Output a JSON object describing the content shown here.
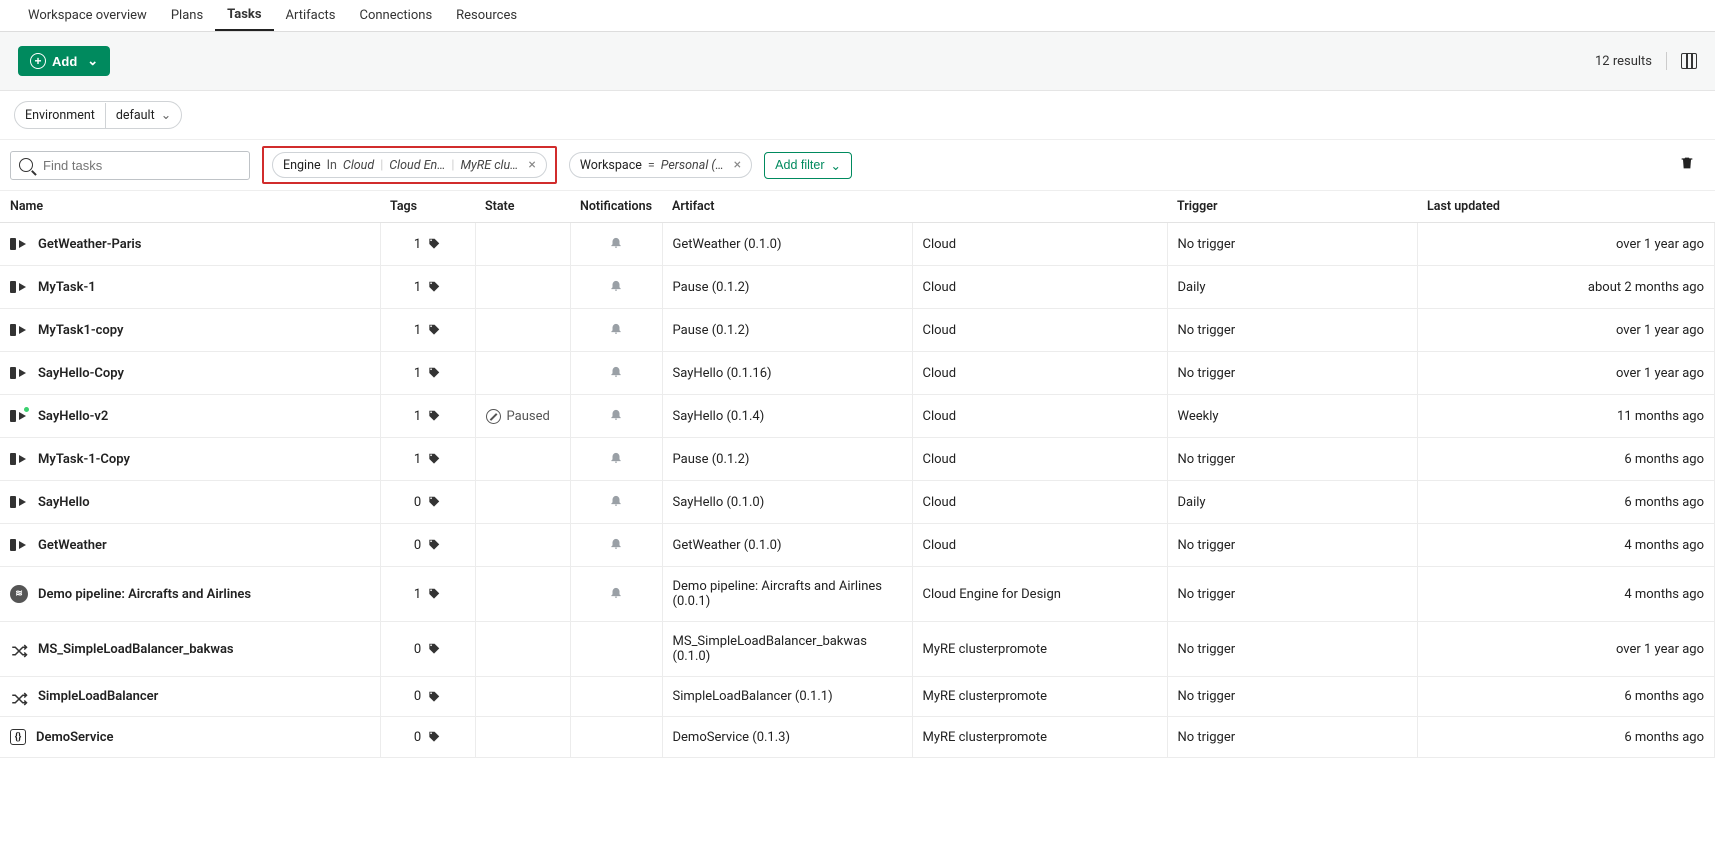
{
  "nav": {
    "items": [
      "Workspace overview",
      "Plans",
      "Tasks",
      "Artifacts",
      "Connections",
      "Resources"
    ],
    "active_index": 2
  },
  "toolbar": {
    "add_label": "Add",
    "results_text": "12 results"
  },
  "env_selector": {
    "label": "Environment",
    "value": "default"
  },
  "search": {
    "placeholder": "Find tasks"
  },
  "filters": {
    "engine": {
      "label": "Engine",
      "operator": "In",
      "values": [
        "Cloud",
        "Cloud En…",
        "MyRE clu…"
      ]
    },
    "workspace": {
      "label": "Workspace",
      "operator": "=",
      "value": "Personal (…"
    },
    "add_filter_label": "Add filter"
  },
  "columns": {
    "name": "Name",
    "tags": "Tags",
    "state": "State",
    "notifications": "Notifications",
    "artifact": "Artifact",
    "engine": "",
    "trigger": "Trigger",
    "last_updated": "Last updated"
  },
  "states": {
    "paused": "Paused"
  },
  "rows": [
    {
      "icon": "task",
      "name": "GetWeather-Paris",
      "tag_count": 1,
      "state": "",
      "notif": true,
      "artifact": "GetWeather (0.1.0)",
      "engine": "Cloud",
      "trigger": "No trigger",
      "updated": "over 1 year ago"
    },
    {
      "icon": "task",
      "name": "MyTask-1",
      "tag_count": 1,
      "state": "",
      "notif": true,
      "artifact": "Pause (0.1.2)",
      "engine": "Cloud",
      "trigger": "Daily",
      "updated": "about 2 months ago"
    },
    {
      "icon": "task",
      "name": "MyTask1-copy",
      "tag_count": 1,
      "state": "",
      "notif": true,
      "artifact": "Pause (0.1.2)",
      "engine": "Cloud",
      "trigger": "No trigger",
      "updated": "over 1 year ago"
    },
    {
      "icon": "task",
      "name": "SayHello-Copy",
      "tag_count": 1,
      "state": "",
      "notif": true,
      "artifact": "SayHello (0.1.16)",
      "engine": "Cloud",
      "trigger": "No trigger",
      "updated": "over 1 year ago"
    },
    {
      "icon": "task-dot",
      "name": "SayHello-v2",
      "tag_count": 1,
      "state": "Paused",
      "notif": true,
      "artifact": "SayHello (0.1.4)",
      "engine": "Cloud",
      "trigger": "Weekly",
      "updated": "11 months ago"
    },
    {
      "icon": "task",
      "name": "MyTask-1-Copy",
      "tag_count": 1,
      "state": "",
      "notif": true,
      "artifact": "Pause (0.1.2)",
      "engine": "Cloud",
      "trigger": "No trigger",
      "updated": "6 months ago"
    },
    {
      "icon": "task",
      "name": "SayHello",
      "tag_count": 0,
      "state": "",
      "notif": true,
      "artifact": "SayHello (0.1.0)",
      "engine": "Cloud",
      "trigger": "Daily",
      "updated": "6 months ago"
    },
    {
      "icon": "task",
      "name": "GetWeather",
      "tag_count": 0,
      "state": "",
      "notif": true,
      "artifact": "GetWeather (0.1.0)",
      "engine": "Cloud",
      "trigger": "No trigger",
      "updated": "4 months ago"
    },
    {
      "icon": "wave",
      "name": "Demo pipeline: Aircrafts and Airlines",
      "tag_count": 1,
      "state": "",
      "notif": true,
      "artifact": "Demo pipeline: Aircrafts and Airlines (0.0.1)",
      "engine": "Cloud Engine for Design",
      "trigger": "No trigger",
      "updated": "4 months ago"
    },
    {
      "icon": "shuffle",
      "name": "MS_SimpleLoadBalancer_bakwas",
      "tag_count": 0,
      "state": "",
      "notif": false,
      "artifact": "MS_SimpleLoadBalancer_bakwas (0.1.0)",
      "engine": "MyRE clusterpromote",
      "trigger": "No trigger",
      "updated": "over 1 year ago"
    },
    {
      "icon": "shuffle",
      "name": "SimpleLoadBalancer",
      "tag_count": 0,
      "state": "",
      "notif": false,
      "artifact": "SimpleLoadBalancer (0.1.1)",
      "engine": "MyRE clusterpromote",
      "trigger": "No trigger",
      "updated": "6 months ago"
    },
    {
      "icon": "service",
      "name": "DemoService",
      "tag_count": 0,
      "state": "",
      "notif": false,
      "artifact": "DemoService (0.1.3)",
      "engine": "MyRE clusterpromote",
      "trigger": "No trigger",
      "updated": "6 months ago"
    }
  ]
}
